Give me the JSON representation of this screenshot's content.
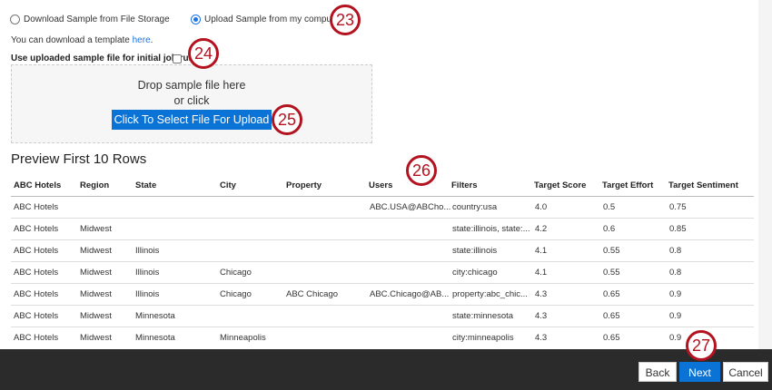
{
  "source_options": [
    {
      "label": "Download Sample from File Storage",
      "selected": false
    },
    {
      "label": "Upload Sample from my computer",
      "selected": true
    }
  ],
  "template_text": "You can download a template ",
  "template_link": "here",
  "template_end": ".",
  "initial_run_label": "Use uploaded sample file for initial job run:",
  "initial_run_checked": false,
  "drop_zone": {
    "line1": "Drop sample file here",
    "line2": "or click",
    "button": "Click To Select File For Upload"
  },
  "preview": {
    "title": "Preview First 10 Rows",
    "columns": [
      "ABC Hotels",
      "Region",
      "State",
      "City",
      "Property",
      "Users",
      "Filters",
      "Target Score",
      "Target Effort",
      "Target Sentiment"
    ],
    "rows": [
      [
        "ABC Hotels",
        "",
        "",
        "",
        "",
        "ABC.USA@ABCho...",
        "country:usa",
        "4.0",
        "0.5",
        "0.75"
      ],
      [
        "ABC Hotels",
        "Midwest",
        "",
        "",
        "",
        "",
        "state:illinois, state:...",
        "4.2",
        "0.6",
        "0.85"
      ],
      [
        "ABC Hotels",
        "Midwest",
        "Illinois",
        "",
        "",
        "",
        "state:illinois",
        "4.1",
        "0.55",
        "0.8"
      ],
      [
        "ABC Hotels",
        "Midwest",
        "Illinois",
        "Chicago",
        "",
        "",
        "city:chicago",
        "4.1",
        "0.55",
        "0.8"
      ],
      [
        "ABC Hotels",
        "Midwest",
        "Illinois",
        "Chicago",
        "ABC Chicago",
        "ABC.Chicago@AB...",
        "property:abc_chic...",
        "4.3",
        "0.65",
        "0.9"
      ],
      [
        "ABC Hotels",
        "Midwest",
        "Minnesota",
        "",
        "",
        "",
        "state:minnesota",
        "4.3",
        "0.65",
        "0.9"
      ],
      [
        "ABC Hotels",
        "Midwest",
        "Minnesota",
        "Minneapolis",
        "",
        "",
        "city:minneapolis",
        "4.3",
        "0.65",
        "0.9"
      ]
    ]
  },
  "footer": {
    "back": "Back",
    "next": "Next",
    "cancel": "Cancel"
  },
  "callouts": [
    "23",
    "24",
    "25",
    "26",
    "27"
  ],
  "colors": {
    "accent": "#0b72d6",
    "callout": "#b3121f",
    "footer": "#2b2b2b"
  }
}
